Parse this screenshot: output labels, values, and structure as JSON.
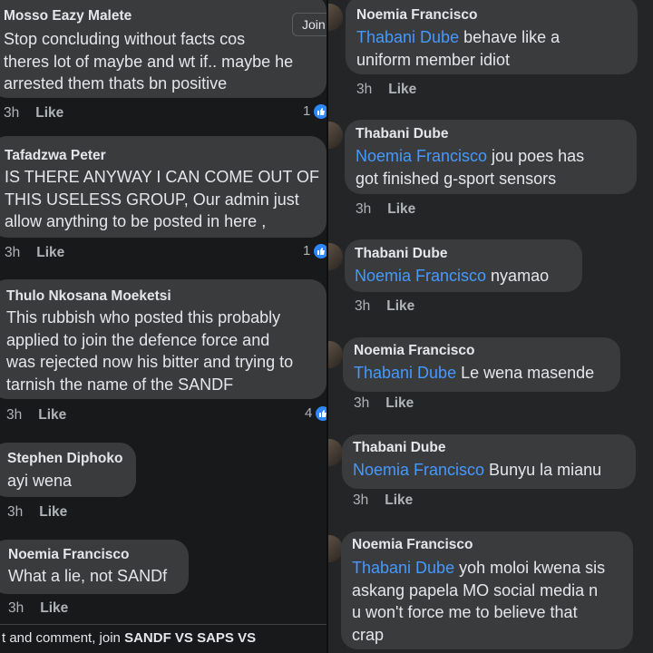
{
  "left_comments": [
    {
      "author": "Mosso Eazy Malete",
      "lines": [
        "Stop concluding without facts cos",
        "theres lot of maybe and wt if.. maybe he",
        "arrested them thats bn positive"
      ],
      "time": "3h",
      "like": "Like",
      "reactions": "1"
    },
    {
      "author": "Tafadzwa Peter",
      "lines": [
        "IS THERE ANYWAY I CAN COME OUT OF",
        "THIS USELESS GROUP, Our admin just",
        "allow anything to be posted in here ,"
      ],
      "time": "3h",
      "like": "Like",
      "reactions": "1"
    },
    {
      "author": "Thulo Nkosana Moeketsi",
      "lines": [
        "This rubbish who posted this probably",
        "applied to join the defence force and",
        "was rejected now his bitter and trying to",
        "tarnish the name of the SANDF"
      ],
      "time": "3h",
      "like": "Like",
      "reactions": "4"
    },
    {
      "author": "Stephen Diphoko",
      "lines": [
        "ayi wena"
      ],
      "time": "3h",
      "like": "Like"
    },
    {
      "author": "Noemia Francisco",
      "lines": [
        "What a lie, not SANDf"
      ],
      "time": "3h",
      "like": "Like"
    }
  ],
  "right_comments": [
    {
      "author": "Noemia Francisco",
      "mention": "Thabani Dube",
      "lines": [
        " behave like a",
        "uniform member idiot"
      ],
      "time": "3h",
      "like": "Like"
    },
    {
      "author": "Thabani Dube",
      "mention": "Noemia Francisco",
      "lines": [
        " jou poes has",
        "got finished g-sport sensors"
      ],
      "time": "3h",
      "like": "Like"
    },
    {
      "author": "Thabani Dube",
      "mention": "Noemia Francisco",
      "lines": [
        " nyamao"
      ],
      "time": "3h",
      "like": "Like"
    },
    {
      "author": "Noemia Francisco",
      "mention": "Thabani Dube",
      "lines": [
        " Le wena masende"
      ],
      "time": "3h",
      "like": "Like"
    },
    {
      "author": "Thabani Dube",
      "mention": "Noemia Francisco",
      "lines": [
        " Bunyu la mianu"
      ],
      "time": "3h",
      "like": "Like"
    },
    {
      "author": "Noemia Francisco",
      "mention": "Thabani Dube",
      "lines": [
        " yoh moloi kwena sis",
        "askang papela MO social media n",
        "u won't force me to believe that",
        "crap"
      ],
      "time": "3h",
      "like": "Like"
    }
  ],
  "footer": {
    "prefix": "t and comment, join ",
    "group": "SANDF VS SAPS VS",
    "join": "Join"
  },
  "colors": {
    "mention": "#4599ff",
    "bubble": "#3a3b3c",
    "reaction": "#2d88ff"
  }
}
